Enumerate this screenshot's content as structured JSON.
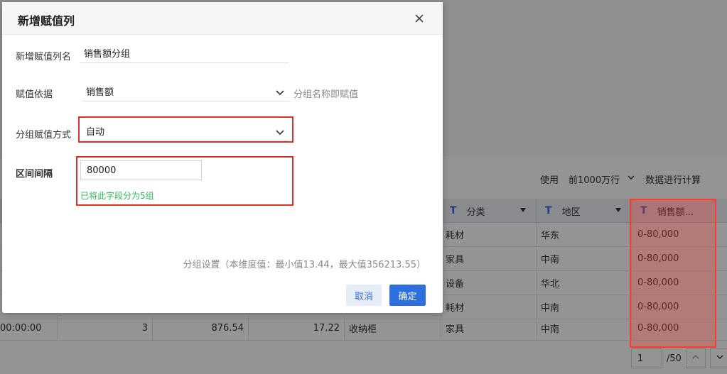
{
  "dialog": {
    "title": "新增赋值列",
    "fields": {
      "name_label": "新增赋值列名",
      "name_value": "销售额分组",
      "basis_label": "赋值依据",
      "basis_value": "销售额",
      "basis_hint": "分组名称即赋值",
      "method_label": "分组赋值方式",
      "method_value": "自动",
      "interval_label": "区间间隔",
      "interval_value": "80000",
      "interval_result": "已将此字段分为5组"
    },
    "stats_text": "分组设置（本维度值：最小值13.44，最大值356213.55）",
    "cancel_label": "取消",
    "confirm_label": "确定",
    "icons": {
      "close": "close-icon",
      "dropdown": "chevron-down-icon"
    },
    "colors": {
      "primary": "#2e6fe0",
      "highlight": "#e0302a",
      "success": "#2dbb57"
    }
  },
  "background": {
    "toolbar": {
      "use_label": "使用",
      "rows_select": "前1000万行",
      "compute_text": "数据进行计算"
    },
    "columns": [
      {
        "type_icon": "T",
        "label": "分类"
      },
      {
        "type_icon": "T",
        "label": "地区"
      },
      {
        "type_icon": "T",
        "label": "销售额..."
      }
    ],
    "rows": [
      {
        "category": "耗材",
        "region": "华东",
        "group": "0-80,000"
      },
      {
        "category": "家具",
        "region": "中南",
        "group": "0-80,000"
      },
      {
        "category": "设备",
        "region": "华北",
        "group": "0-80,000"
      },
      {
        "category": "耗材",
        "region": "中南",
        "group": "0-80,000"
      },
      {
        "time": "00:00:00",
        "qty": "3",
        "amount": "876.54",
        "profit": "17.22",
        "product": "收纳柜",
        "category": "家具",
        "region": "中南",
        "group": "0-80,000"
      }
    ],
    "pager": {
      "page": "1",
      "total": "/50"
    }
  }
}
